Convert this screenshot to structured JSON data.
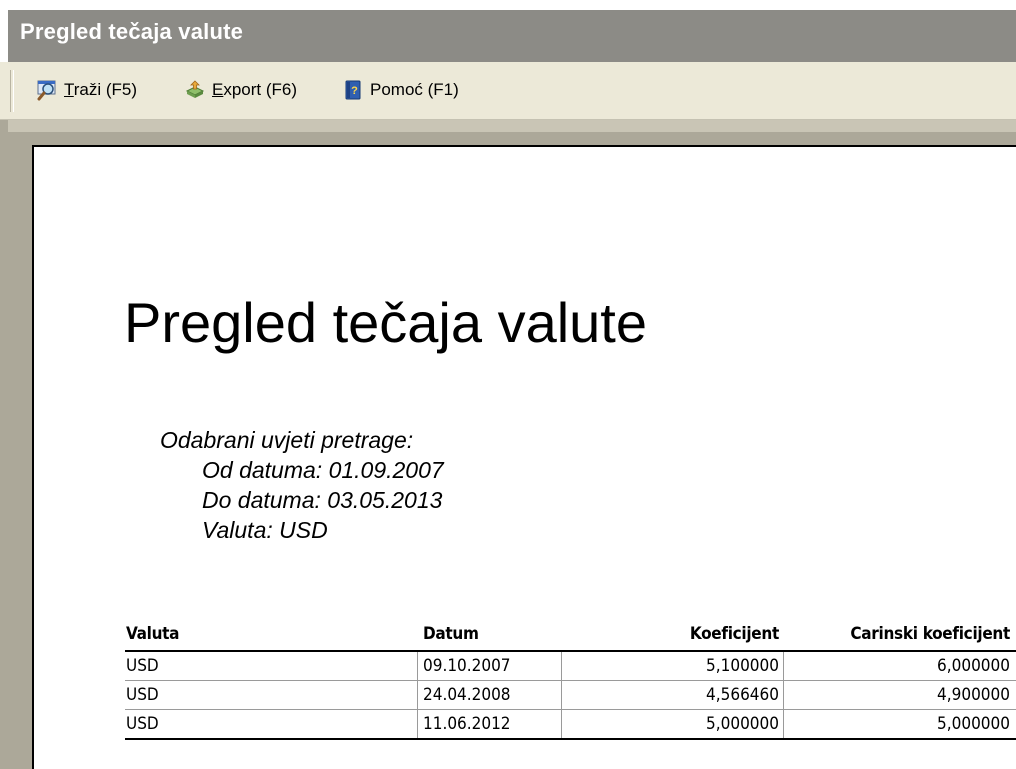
{
  "window": {
    "title": "Pregled tečaja valute"
  },
  "toolbar": {
    "search": {
      "accel": "T",
      "rest": "raži (F5)",
      "icon": "search-icon"
    },
    "export": {
      "accel": "E",
      "rest": "xport (F6)",
      "icon": "export-icon"
    },
    "help": {
      "label": "Pomoć (F1)",
      "icon": "help-book-icon"
    }
  },
  "report": {
    "title": "Pregled tečaja valute",
    "criteria_heading": "Odabrani uvjeti pretrage:",
    "criteria": [
      "Od datuma: 01.09.2007",
      "Do datuma: 03.05.2013",
      "Valuta: USD"
    ],
    "table": {
      "headers": [
        "Valuta",
        "Datum",
        "Koeficijent",
        "Carinski koeficijent"
      ],
      "rows": [
        [
          "USD",
          "09.10.2007",
          "5,100000",
          "6,000000"
        ],
        [
          "USD",
          "24.04.2008",
          "4,566460",
          "4,900000"
        ],
        [
          "USD",
          "11.06.2012",
          "5,000000",
          "5,000000"
        ]
      ]
    }
  },
  "colors": {
    "titlebar": "#8c8b86",
    "toolbar": "#ece9d8",
    "workspace": "#aca899",
    "paper": "#ffffff"
  }
}
